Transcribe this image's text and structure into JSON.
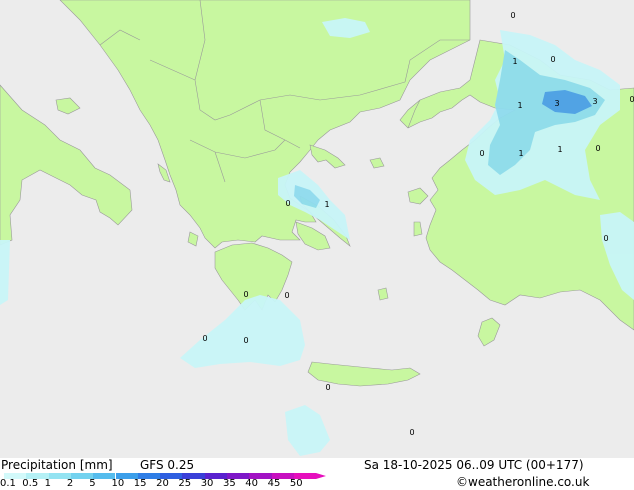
{
  "map": {
    "point_labels": [
      {
        "name": "label-0-north-top",
        "text": "0"
      },
      {
        "name": "label-1-black-sea-west",
        "text": "1"
      },
      {
        "name": "label-0-black-sea-coast",
        "text": "0"
      },
      {
        "name": "label-1-thrace",
        "text": "1"
      },
      {
        "name": "label-3-istanbul",
        "text": "3"
      },
      {
        "name": "label-3-black-sea-east",
        "text": "3"
      },
      {
        "name": "label-0-east-edge",
        "text": "0"
      },
      {
        "name": "label-0-marmara-south",
        "text": "0"
      },
      {
        "name": "label-1-anatolia-west",
        "text": "1"
      },
      {
        "name": "label-1-anatolia-inner",
        "text": "1"
      },
      {
        "name": "label-0-anatolia-east",
        "text": "0"
      },
      {
        "name": "label-0-evia",
        "text": "0"
      },
      {
        "name": "label-1-evia-east",
        "text": "1"
      },
      {
        "name": "label-0-turkey-south-east",
        "text": "0"
      },
      {
        "name": "label-0-peloponnese-west",
        "text": "0"
      },
      {
        "name": "label-0-peloponnese-south",
        "text": "0"
      },
      {
        "name": "label-0-ionian-sea-a",
        "text": "0"
      },
      {
        "name": "label-0-ionian-sea-b",
        "text": "0"
      },
      {
        "name": "label-0-crete-south",
        "text": "0"
      },
      {
        "name": "label-0-libyan-sea",
        "text": "0"
      }
    ]
  },
  "footer": {
    "title": "Precipitation [mm]",
    "model": "GFS 0.25",
    "datetime": "Sa 18-10-2025 06..09 UTC (00+177)",
    "credit": "©weatheronline.co.uk"
  },
  "legend": {
    "ticks": [
      "0.1",
      "0.5",
      "1",
      "2",
      "5",
      "10",
      "15",
      "20",
      "25",
      "30",
      "35",
      "40",
      "45",
      "50"
    ],
    "colors": [
      "#d2f9fa",
      "#b4f0f5",
      "#93e3f2",
      "#73d2ef",
      "#55bced",
      "#3c9fea",
      "#2f7ee6",
      "#2f5fe0",
      "#3a3fd8",
      "#5a22cf",
      "#7e18c8",
      "#a213c4",
      "#c710c0",
      "#e60fbd"
    ]
  },
  "colors": {
    "sea": "#ececec",
    "land": "#c8f7a0",
    "border": "#9a9a9a",
    "precip_light": "#c8f5f8",
    "precip_medium": "#8fdcef",
    "precip_heavy": "#4b9fe8"
  }
}
